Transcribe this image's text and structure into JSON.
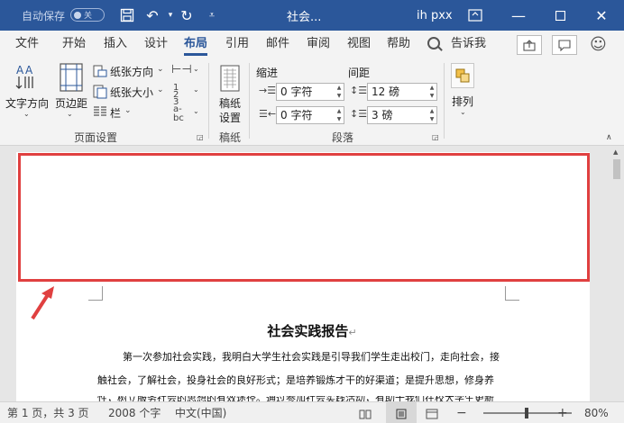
{
  "titlebar": {
    "autosave_label": "自动保存",
    "autosave_toggle": "关",
    "doc_title": "社会...",
    "user_name": "ih pxx"
  },
  "menu": [
    "文件",
    "开始",
    "插入",
    "设计",
    "布局",
    "引用",
    "邮件",
    "审阅",
    "视图",
    "帮助",
    "告诉我"
  ],
  "menu_active": "布局",
  "ribbon": {
    "text_direction": "文字方向",
    "margins": "页边距",
    "orientation": "纸张方向",
    "size": "纸张大小",
    "columns": "栏",
    "page_setup_group": "页面设置",
    "manuscript_btn_line1": "稿纸",
    "manuscript_btn_line2": "设置",
    "manuscript_group": "稿纸",
    "indent_label": "缩进",
    "spacing_label": "间距",
    "indent_left": "0 字符",
    "indent_right": "0 字符",
    "spacing_before": "12 磅",
    "spacing_after": "3 磅",
    "paragraph_group": "段落",
    "arrange": "排列"
  },
  "document": {
    "heading": "社会实践报告",
    "lines": [
      "第一次参加社会实践，我明白大学生社会实践是引导我们学生走出校门，走向社会，接",
      "触社会，了解社会，投身社会的良好形式；是培养锻炼才干的好渠道；是提升思想，修身养",
      "性，树立服务社会的思想的有效途径。通过参加社会实践活动，有助于我们在校大学生更新"
    ]
  },
  "status": {
    "page": "第 1 页，共 3 页",
    "words": "2008 个字",
    "language": "中文(中国)",
    "zoom": "80%"
  },
  "colors": {
    "titlebar": "#2b579a",
    "highlight": "#e04040"
  }
}
